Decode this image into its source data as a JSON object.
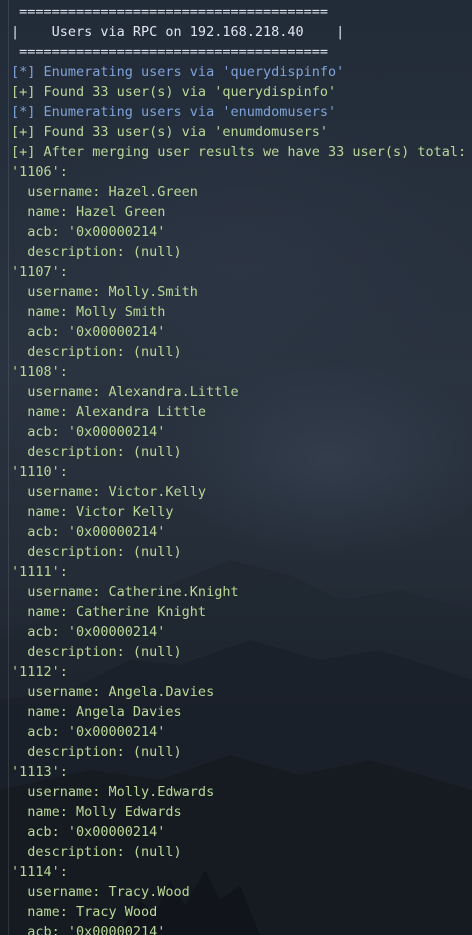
{
  "terminal": {
    "banner": {
      "rule_top": " ======================================",
      "title": "|    Users via RPC on 192.168.218.40    |",
      "rule_bottom": " ======================================"
    },
    "messages": [
      {
        "kind": "info",
        "text": "[*] Enumerating users via 'querydispinfo'"
      },
      {
        "kind": "ok",
        "text": "[+] Found 33 user(s) via 'querydispinfo'"
      },
      {
        "kind": "info",
        "text": "[*] Enumerating users via 'enumdomusers'"
      },
      {
        "kind": "ok",
        "text": "[+] Found 33 user(s) via 'enumdomusers'"
      },
      {
        "kind": "ok",
        "text": "[+] After merging user results we have 33 user(s) total:"
      }
    ],
    "users": [
      {
        "rid": "'1106':",
        "username": "  username: Hazel.Green",
        "name": "  name: Hazel Green",
        "acb": "  acb: '0x00000214'",
        "description": "  description: (null)"
      },
      {
        "rid": "'1107':",
        "username": "  username: Molly.Smith",
        "name": "  name: Molly Smith",
        "acb": "  acb: '0x00000214'",
        "description": "  description: (null)"
      },
      {
        "rid": "'1108':",
        "username": "  username: Alexandra.Little",
        "name": "  name: Alexandra Little",
        "acb": "  acb: '0x00000214'",
        "description": "  description: (null)"
      },
      {
        "rid": "'1110':",
        "username": "  username: Victor.Kelly",
        "name": "  name: Victor Kelly",
        "acb": "  acb: '0x00000214'",
        "description": "  description: (null)"
      },
      {
        "rid": "'1111':",
        "username": "  username: Catherine.Knight",
        "name": "  name: Catherine Knight",
        "acb": "  acb: '0x00000214'",
        "description": "  description: (null)"
      },
      {
        "rid": "'1112':",
        "username": "  username: Angela.Davies",
        "name": "  name: Angela Davies",
        "acb": "  acb: '0x00000214'",
        "description": "  description: (null)"
      },
      {
        "rid": "'1113':",
        "username": "  username: Molly.Edwards",
        "name": "  name: Molly Edwards",
        "acb": "  acb: '0x00000214'",
        "description": "  description: (null)"
      },
      {
        "rid": "'1114':",
        "username": "  username: Tracy.Wood",
        "name": "  name: Tracy Wood",
        "acb": "  acb: '0x00000214'"
      }
    ]
  },
  "colors": {
    "background": "#1c2330",
    "info": "#7fa3d9",
    "ok": "#b9d898",
    "text": "#dfe6ef"
  }
}
